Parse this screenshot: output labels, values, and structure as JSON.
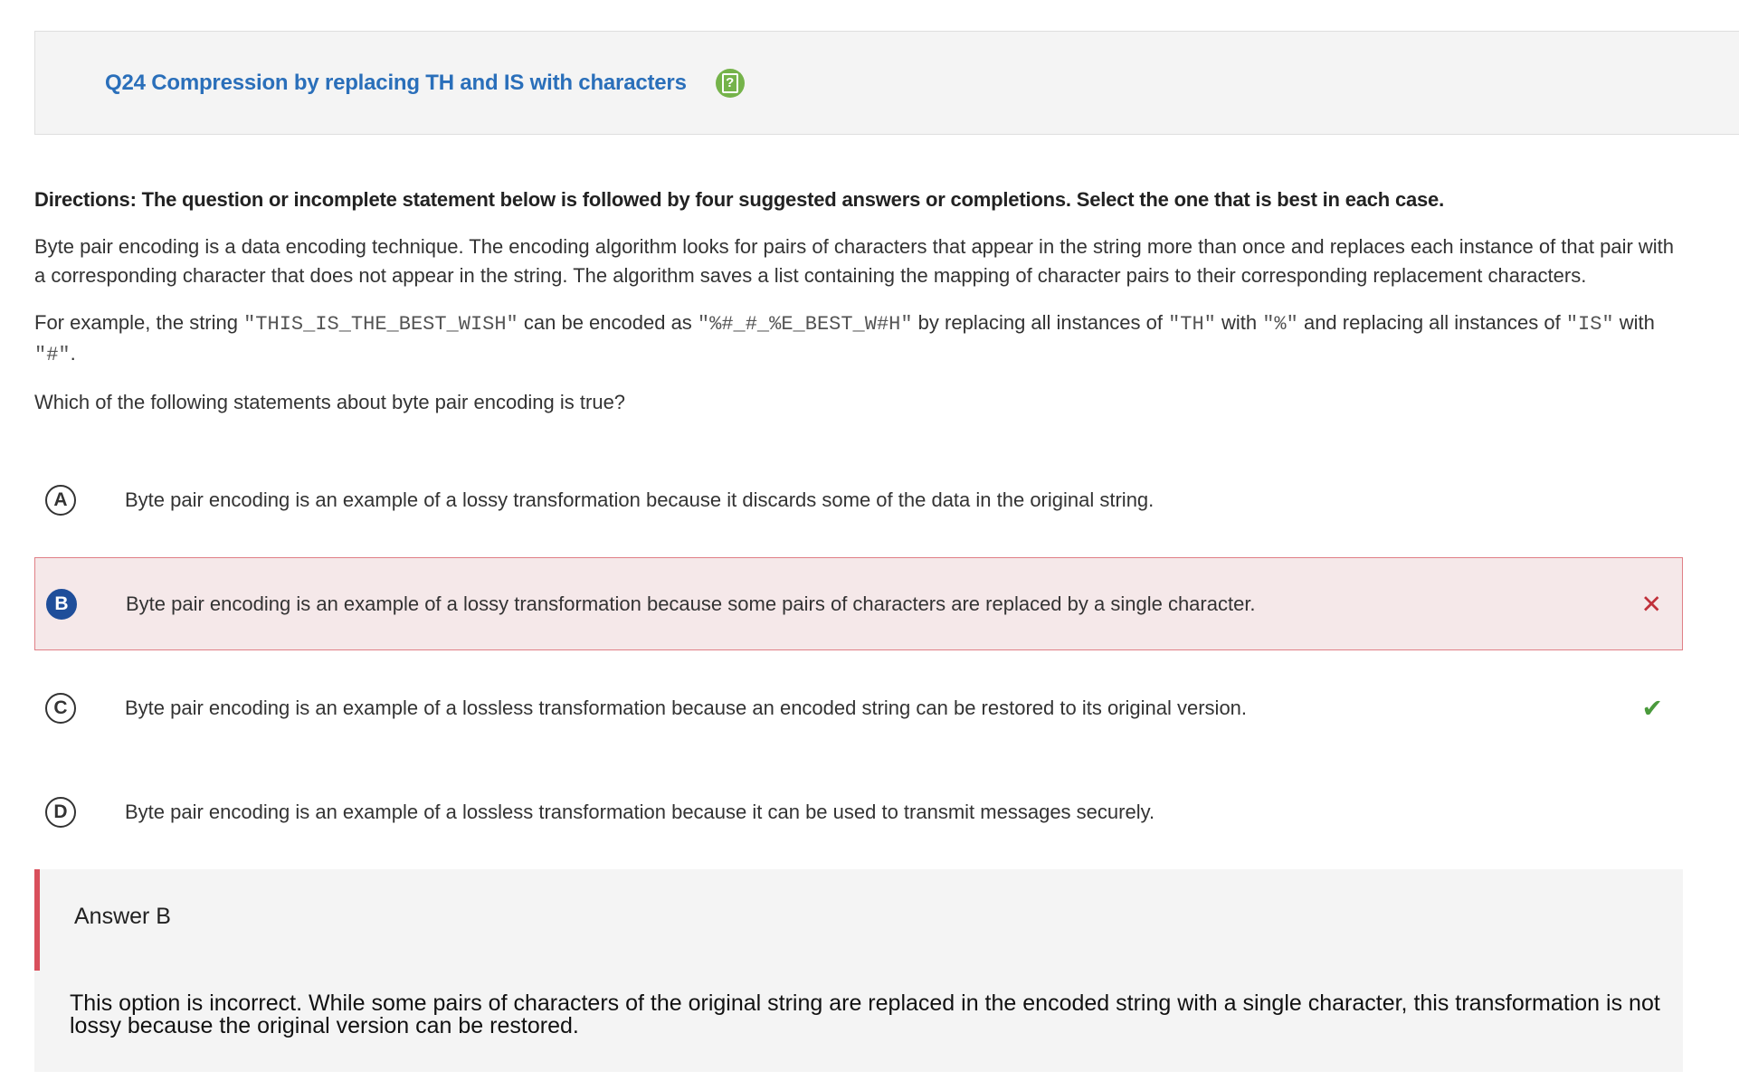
{
  "header": {
    "title": "Q24 Compression by replacing TH and IS with characters",
    "help_icon": "help-icon",
    "accent_color": "#2a6fba",
    "help_color": "#75b34a"
  },
  "directions": "Directions: The question or incomplete statement below is followed by four suggested answers or completions. Select the one that is best in each case.",
  "intro": "Byte pair encoding is a data encoding technique. The encoding algorithm looks for pairs of characters that appear in the string more than once and replaces each instance of that pair with a corresponding character that does not appear in the string. The algorithm saves a list containing the mapping of character pairs to their corresponding replacement characters.",
  "example": {
    "t1": "For example, the string ",
    "c1": "\"THIS_IS_THE_BEST_WISH\"",
    "t2": " can be encoded as ",
    "c2": "\"%#_#_%E_BEST_W#H\"",
    "t3": " by replacing all instances of ",
    "c3": "\"TH\"",
    "t4": " with ",
    "c4": "\"%\"",
    "t5": " and replacing all instances of ",
    "c5": "\"IS\"",
    "t6": " with ",
    "c6": "\"#\"",
    "t7": "."
  },
  "question": "Which of the following statements about byte pair encoding is true?",
  "choices": [
    {
      "letter": "A",
      "text": "Byte pair encoding is an example of a lossy transformation because it discards some of the data in the original string.",
      "state": "none"
    },
    {
      "letter": "B",
      "text": "Byte pair encoding is an example of a lossy transformation because some pairs of characters are replaced by a single character.",
      "state": "selected-incorrect",
      "mark": "✕"
    },
    {
      "letter": "C",
      "text": "Byte pair encoding is an example of a lossless transformation because an encoded string can be restored to its original version.",
      "state": "correct",
      "mark": "✔"
    },
    {
      "letter": "D",
      "text": "Byte pair encoding is an example of a lossless transformation because it can be used to transmit messages securely.",
      "state": "none"
    }
  ],
  "feedback": {
    "label": "Answer B",
    "explanation": "This option is incorrect. While some pairs of characters of the original string are replaced in the encoded string with a single character, this transformation is not lossy because the original version can be restored.",
    "bar_color": "#d94f5c"
  }
}
